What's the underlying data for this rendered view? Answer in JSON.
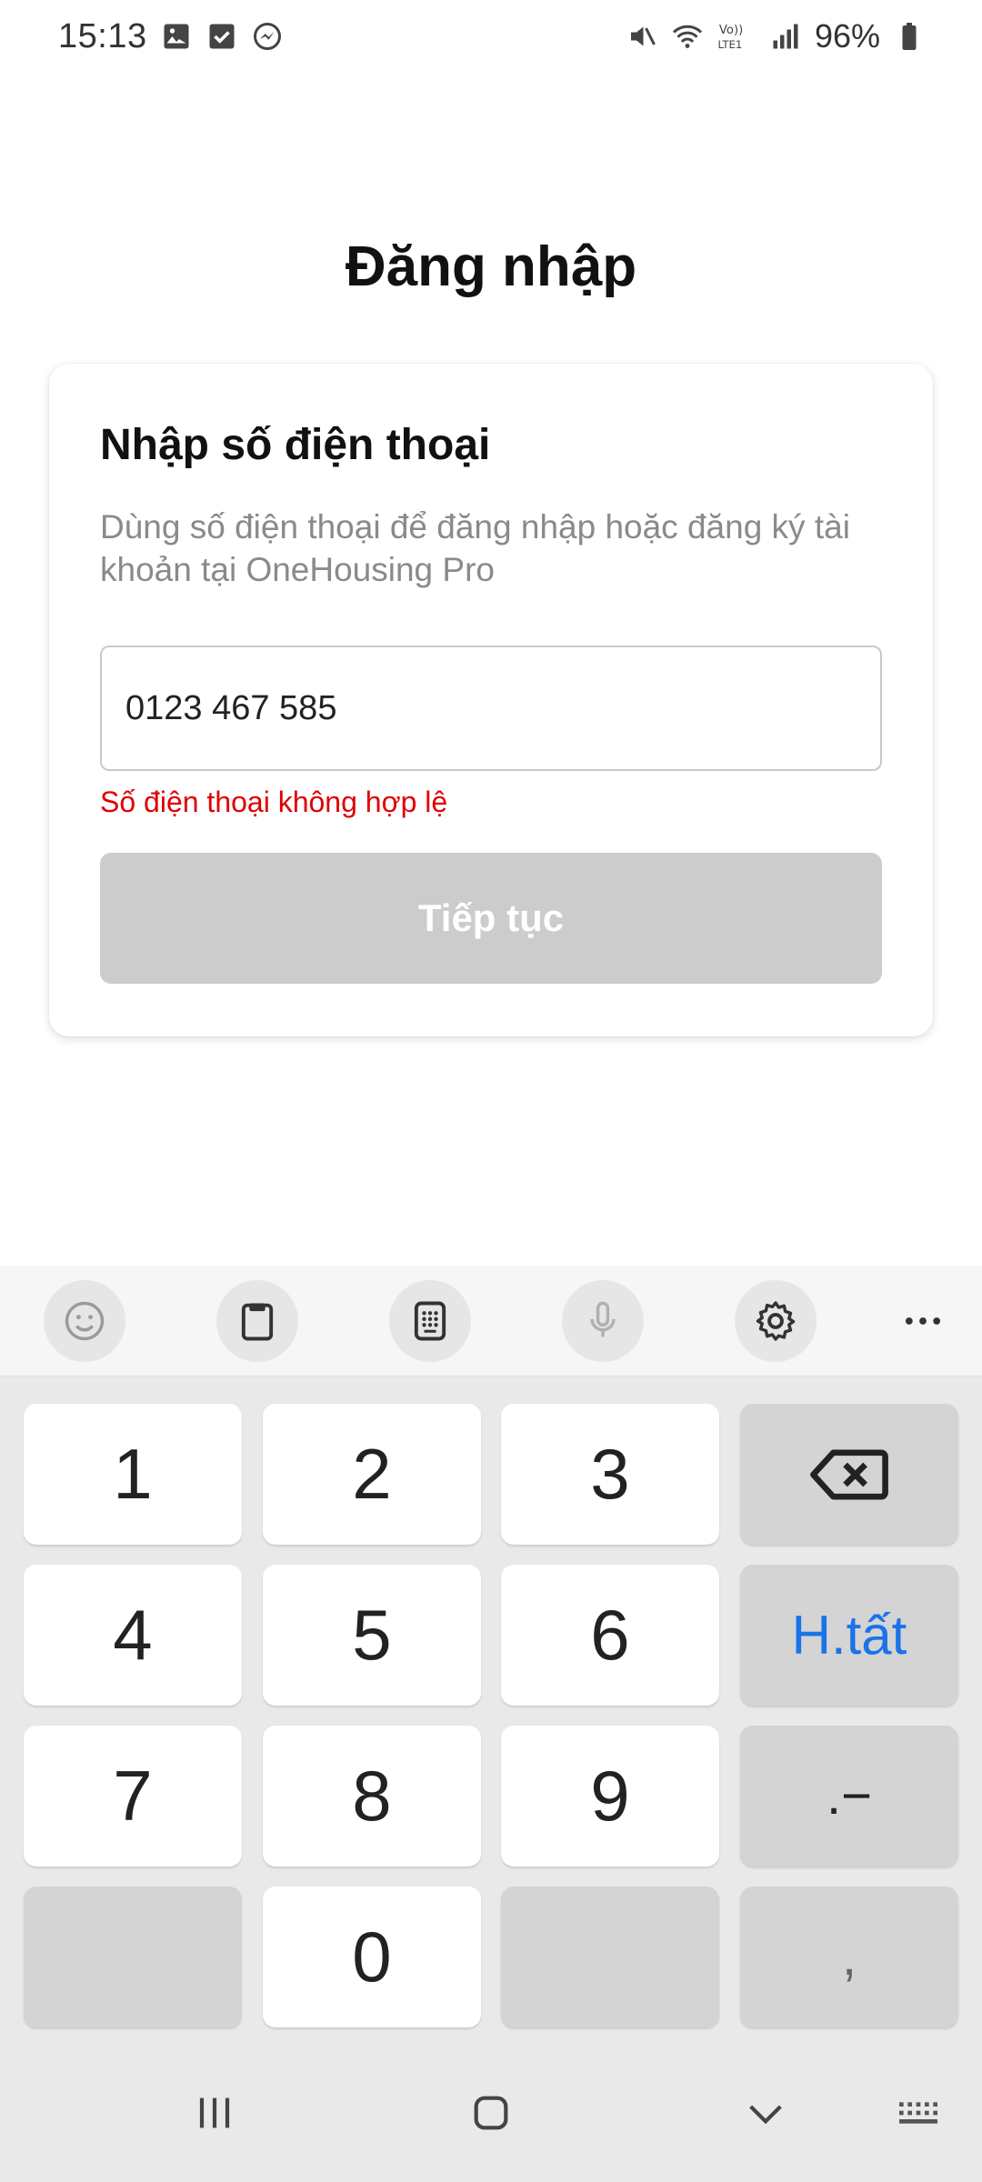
{
  "status_bar": {
    "time": "15:13",
    "battery": "96%",
    "left_icons": [
      "gallery-icon",
      "checkbox-icon",
      "messenger-icon"
    ],
    "right_icons": [
      "mute-icon",
      "wifi-icon",
      "volte-icon",
      "signal-icon",
      "battery-icon"
    ],
    "volte_text": "Vo)) LTE1"
  },
  "page": {
    "title": "Đăng nhập"
  },
  "login_card": {
    "title": "Nhập số điện thoại",
    "description": "Dùng số điện thoại để đăng nhập hoặc đăng ký tài khoản tại OneHousing Pro",
    "phone_value": "0123 467 585",
    "error": "Số điện thoại không hợp lệ",
    "continue_label": "Tiếp tục"
  },
  "keyboard_toolbar": {
    "items": [
      "emoji-icon",
      "clipboard-icon",
      "keypad-icon",
      "microphone-icon",
      "settings-icon",
      "more-icon"
    ]
  },
  "keyboard": {
    "keys": {
      "k1": "1",
      "k2": "2",
      "k3": "3",
      "k4": "4",
      "k5": "5",
      "k6": "6",
      "k7": "7",
      "k8": "8",
      "k9": "9",
      "k0": "0",
      "done": "H.tất",
      "dot_dash": ".−",
      "comma": ","
    }
  },
  "colors": {
    "error": "#e00000",
    "button_disabled": "#cccccc",
    "accent": "#1a73e8"
  }
}
